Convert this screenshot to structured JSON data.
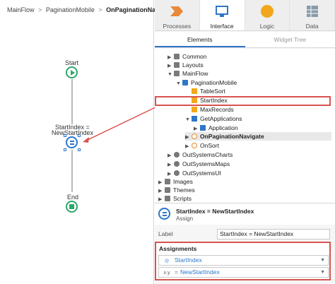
{
  "breadcrumb": {
    "items": [
      "MainFlow",
      "PaginationMobile"
    ],
    "current": "OnPaginationNavigate",
    "separator": ">"
  },
  "canvas": {
    "start_label": "Start",
    "assign_label_line1": "StartIndex =",
    "assign_label_line2": "NewStartIndex",
    "end_label": "End"
  },
  "top_tabs": [
    {
      "label": "Processes",
      "icon": "processes-icon"
    },
    {
      "label": "Interface",
      "icon": "interface-icon"
    },
    {
      "label": "Logic",
      "icon": "logic-icon"
    },
    {
      "label": "Data",
      "icon": "data-icon"
    }
  ],
  "sub_tabs": [
    "Elements",
    "Widget Tree"
  ],
  "tree": [
    {
      "label": "Common",
      "arrow": "▶",
      "icon": "folder"
    },
    {
      "label": "Layouts",
      "arrow": "▶",
      "icon": "folder"
    },
    {
      "label": "MainFlow",
      "arrow": "▼",
      "icon": "folder"
    },
    {
      "label": "PaginationMobile",
      "arrow": "▼",
      "icon": "module"
    },
    {
      "label": "TableSort",
      "arrow": "",
      "icon": "var"
    },
    {
      "label": "StartIndex",
      "arrow": "",
      "icon": "var"
    },
    {
      "label": "MaxRecords",
      "arrow": "",
      "icon": "var"
    },
    {
      "label": "GetApplications",
      "arrow": "▼",
      "icon": "grid"
    },
    {
      "label": "Application",
      "arrow": "▶",
      "icon": "grid"
    },
    {
      "label": "OnPaginationNavigate",
      "arrow": "▶",
      "icon": "action"
    },
    {
      "label": "OnSort",
      "arrow": "▶",
      "icon": "action"
    },
    {
      "label": "OutSystemsCharts",
      "arrow": "▶",
      "icon": "gear"
    },
    {
      "label": "OutSystemsMaps",
      "arrow": "▶",
      "icon": "gear"
    },
    {
      "label": "OutSystemsUI",
      "arrow": "▶",
      "icon": "gear"
    },
    {
      "label": "Images",
      "arrow": "▶",
      "icon": "folder"
    },
    {
      "label": "Themes",
      "arrow": "▶",
      "icon": "folder"
    },
    {
      "label": "Scripts",
      "arrow": "▶",
      "icon": "folder"
    }
  ],
  "properties": {
    "title": "StartIndex = NewStartIndex",
    "subtitle": "Assign",
    "label_name": "Label",
    "label_value": "StartIndex = NewStartIndex"
  },
  "assignments": {
    "title": "Assignments",
    "variable": "StartIndex",
    "value": "NewStartIndex",
    "value_prefix": "x.y",
    "equals": "="
  },
  "colors": {
    "accent": "#2e76c8",
    "start_end": "#2ea86b",
    "highlight": "#d9534f",
    "processes_icon": "#e8893a",
    "interface_icon": "#2e76c8",
    "logic_icon": "#f2a71b",
    "data_icon": "#8a9aa8"
  }
}
